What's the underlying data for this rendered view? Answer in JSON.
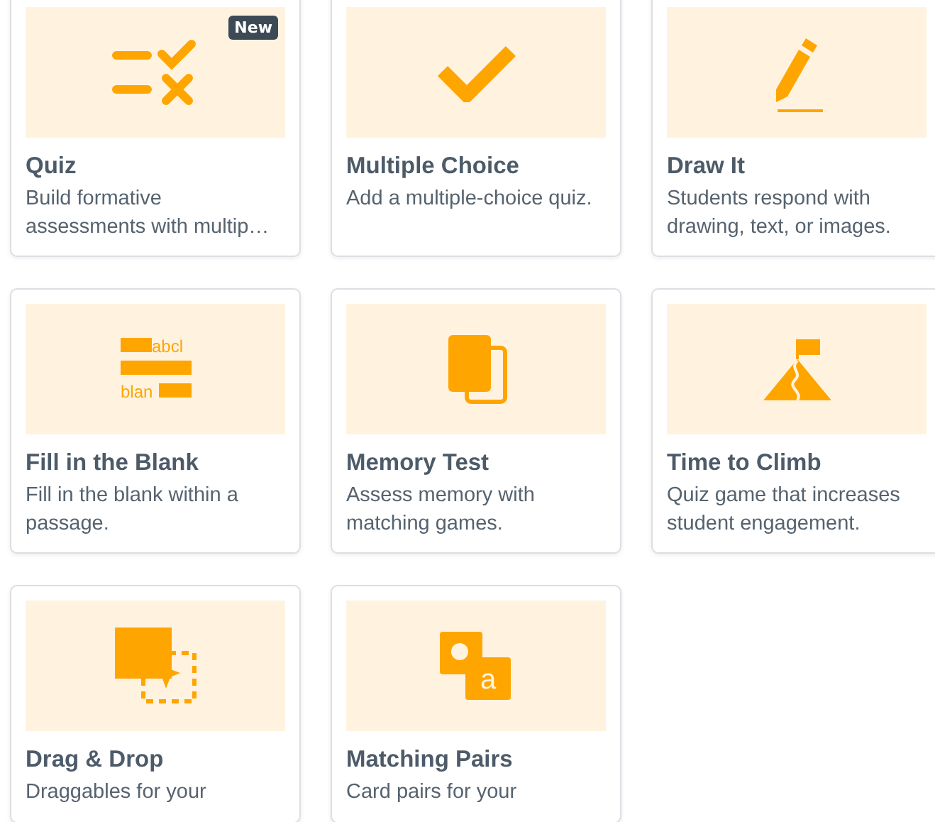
{
  "cards": [
    {
      "title": "Quiz",
      "description": "Build formative assessments with multip…",
      "badge": "New"
    },
    {
      "title": "Multiple Choice",
      "description": "Add a multiple-choice quiz."
    },
    {
      "title": "Draw It",
      "description": "Students respond with drawing, text, or images."
    },
    {
      "title": "Fill in the Blank",
      "description": "Fill in the blank within a passage.",
      "icon_text": [
        "abcl",
        "blan"
      ]
    },
    {
      "title": "Memory Test",
      "description": "Assess memory with matching games."
    },
    {
      "title": "Time to Climb",
      "description": "Quiz game that increases student engagement."
    },
    {
      "title": "Drag & Drop",
      "description": "Draggables for your"
    },
    {
      "title": "Matching Pairs",
      "description": "Card pairs for your",
      "icon_text": [
        "a"
      ]
    }
  ]
}
